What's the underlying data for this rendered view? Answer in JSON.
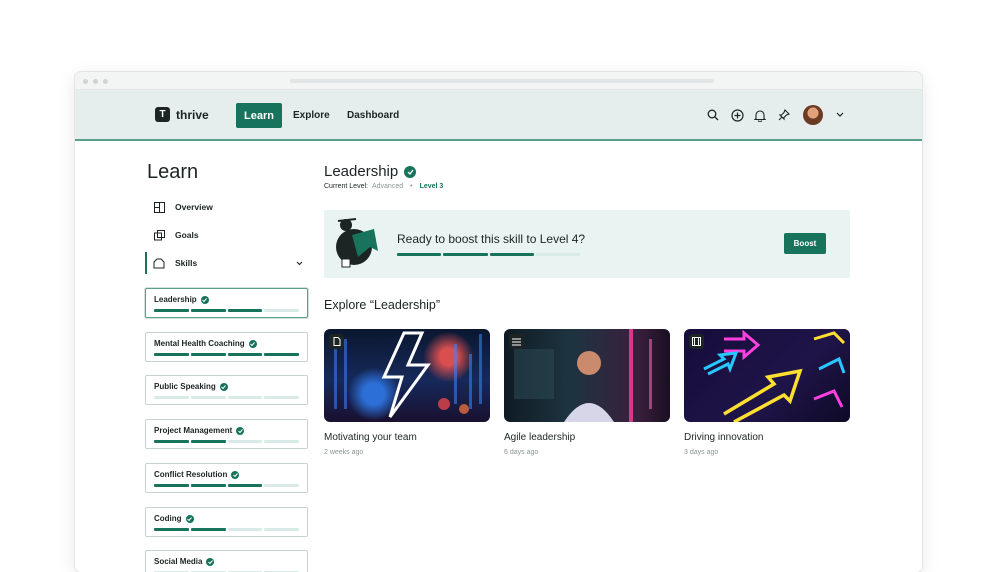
{
  "app": {
    "logo_mark": "T",
    "logo_text": "thrive"
  },
  "nav": {
    "items": [
      {
        "label": "Learn",
        "active": true
      },
      {
        "label": "Explore",
        "active": false
      },
      {
        "label": "Dashboard",
        "active": false
      }
    ],
    "icons": [
      "search-icon",
      "add-circle-icon",
      "bell-icon",
      "pin-icon",
      "chevron-down-icon"
    ]
  },
  "sidebar": {
    "title": "Learn",
    "items": [
      {
        "label": "Overview",
        "icon": "grid-icon"
      },
      {
        "label": "Goals",
        "icon": "goals-icon"
      },
      {
        "label": "Skills",
        "icon": "skills-icon"
      }
    ],
    "skills": [
      {
        "name": "Leadership",
        "progress": 3,
        "total": 4,
        "selected": true
      },
      {
        "name": "Mental Health Coaching",
        "progress": 4,
        "total": 4,
        "selected": false
      },
      {
        "name": "Public Speaking",
        "progress": 0,
        "total": 4,
        "selected": false
      },
      {
        "name": "Project Management",
        "progress": 2,
        "total": 4,
        "selected": false
      },
      {
        "name": "Conflict Resolution",
        "progress": 3,
        "total": 4,
        "selected": false
      },
      {
        "name": "Coding",
        "progress": 2,
        "total": 4,
        "selected": false
      },
      {
        "name": "Social Media",
        "progress": 0,
        "total": 4,
        "selected": false
      }
    ]
  },
  "main": {
    "title": "Leadership",
    "current_level_label": "Current Level:",
    "current_level_value": "Advanced",
    "separator": "•",
    "level": "Level 3",
    "boost": {
      "text": "Ready to boost this skill to Level 4?",
      "button": "Boost",
      "progress": 3,
      "total": 4
    },
    "explore_title": "Explore “Leadership”",
    "cards": [
      {
        "title": "Motivating your team",
        "date": "2 weeks ago",
        "badge": "document-icon"
      },
      {
        "title": "Agile leadership",
        "date": "6 days ago",
        "badge": "quote-icon"
      },
      {
        "title": "Driving innovation",
        "date": "3 days ago",
        "badge": "film-icon"
      }
    ]
  },
  "colors": {
    "accent": "#17735c",
    "accent_light": "#d9ebe6",
    "nav_bg": "#e6eded"
  }
}
